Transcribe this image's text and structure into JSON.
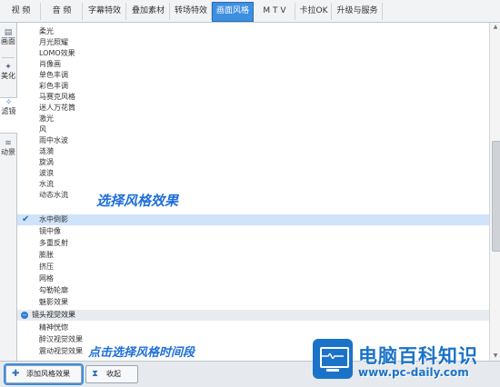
{
  "tabs": [
    "视 频",
    "音 频",
    "字幕特效",
    "叠加素材",
    "转场特效",
    "画面风格",
    "M T V",
    "卡拉OK",
    "升级与服务"
  ],
  "active_tab": "画面风格",
  "side_tabs": [
    {
      "icon": "picture-icon",
      "label": "画面"
    },
    {
      "icon": "magic-wand-icon",
      "label": "美化"
    },
    {
      "icon": "filter-wand-icon",
      "label": "滤镜"
    },
    {
      "icon": "motion-waves-icon",
      "label": "动景"
    }
  ],
  "list_items": [
    "柔光",
    "月光照耀",
    "LOMO效果",
    "肖像画",
    "单色丰调",
    "彩色丰调",
    "马赛克风格",
    "迷人万花筒",
    "激光",
    "风",
    "雨中水波",
    "涟漪",
    "旋涡",
    "波浪",
    "水流",
    "动态水流",
    "水中倒影",
    "镜中像",
    "多重反射",
    "膨胀",
    "挤压",
    "网格",
    "勾勒轮廓",
    "魅影效果"
  ],
  "selected_item": "水中倒影",
  "group_header": "镜头视觉效果",
  "group_items": [
    "精神恍惚",
    "醉汉视觉效果",
    "震动视觉效果"
  ],
  "buttons": {
    "add": "添加风格效果",
    "collapse": "收起"
  },
  "annotations": {
    "select_effect": "选择风格效果",
    "add_effect": "点击选择风格时间段"
  },
  "watermark": {
    "title": "电脑百科知识",
    "url": "www.pc-daily.com"
  },
  "colors": {
    "accent": "#3d8fe0",
    "selection": "#cfe3fa",
    "annotation": "#1e6fd9",
    "watermark": "#1a73c9"
  }
}
